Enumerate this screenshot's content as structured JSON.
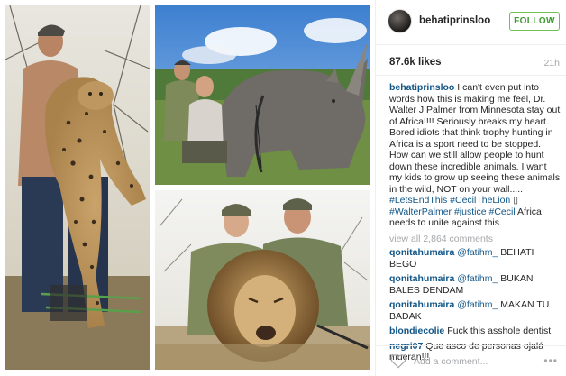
{
  "post": {
    "username": "behatiprinsloo",
    "follow_label": "FOLLOW",
    "likes": "87.6k likes",
    "time": "21h"
  },
  "caption": {
    "username": "behatiprinsloo",
    "text": "I can't even put into words how this is making me feel, Dr. Walter J Palmer from Minnesota stay out of Africa!!!! Seriously breaks my heart. Bored idiots that think trophy hunting in Africa is a sport need to be stopped. How can we still allow people to hunt down these incredible animals. I want my kids to grow up seeing these animals in the wild, NOT on your wall.....",
    "tags": [
      "#LetsEndThis",
      "#CecilTheLion",
      "▯",
      "#WalterPalmer",
      "#justice",
      "#Cecil"
    ],
    "tail": "Africa needs to unite against this."
  },
  "view_all": "view all 2,864 comments",
  "comments": [
    {
      "user": "qonitahumaira",
      "mention": "@fatihm_",
      "text": "BEHATI BEGO"
    },
    {
      "user": "qonitahumaira",
      "mention": "@fatihm_",
      "text": "BUKAN BALES DENDAM"
    },
    {
      "user": "qonitahumaira",
      "mention": "@fatihm_",
      "text": "MAKAN TU BADAK"
    },
    {
      "user": "blondiecolie",
      "mention": "",
      "text": "Fuck this asshole dentist"
    },
    {
      "user": "negri07",
      "mention": "",
      "text": "Que asco de personas ojalá mueran!!!"
    }
  ],
  "add_comment_placeholder": "Add a comment...",
  "more_label": "•••",
  "icons": {
    "avatar": "avatar-image",
    "like": "heart-outline-icon",
    "more": "more-options-icon"
  }
}
